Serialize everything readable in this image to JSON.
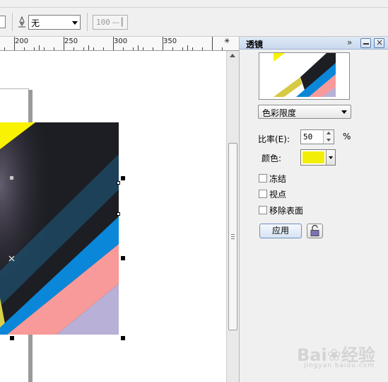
{
  "toolbar": {
    "outline_value": "无",
    "opacity_value": "100",
    "opacity_suffix": "—┃"
  },
  "ruler": {
    "labels": [
      "200",
      "250",
      "300",
      "350"
    ],
    "corner_icon": "✳"
  },
  "panel": {
    "title": "透镜",
    "expand_icon": "»",
    "type_value": "色彩限度",
    "rate_label": "比率(E):",
    "rate_value": "50",
    "rate_unit": "%",
    "color_label": "颜色:",
    "color_value": "#f2ee06",
    "freeze_label": "冻结",
    "viewpoint_label": "视点",
    "remove_face_label": "移除表面",
    "apply_label": "应用"
  },
  "watermark": {
    "text": "Bai❀经验",
    "sub": "jingyan.baidu.com"
  },
  "colors": {
    "artwork_dark": "#1c1e23",
    "stripe_blue": "#0a87d8",
    "stripe_pink": "#f89a9a",
    "stripe_lavender": "#b8b0d6",
    "stripe_yellow": "#f9f200"
  }
}
